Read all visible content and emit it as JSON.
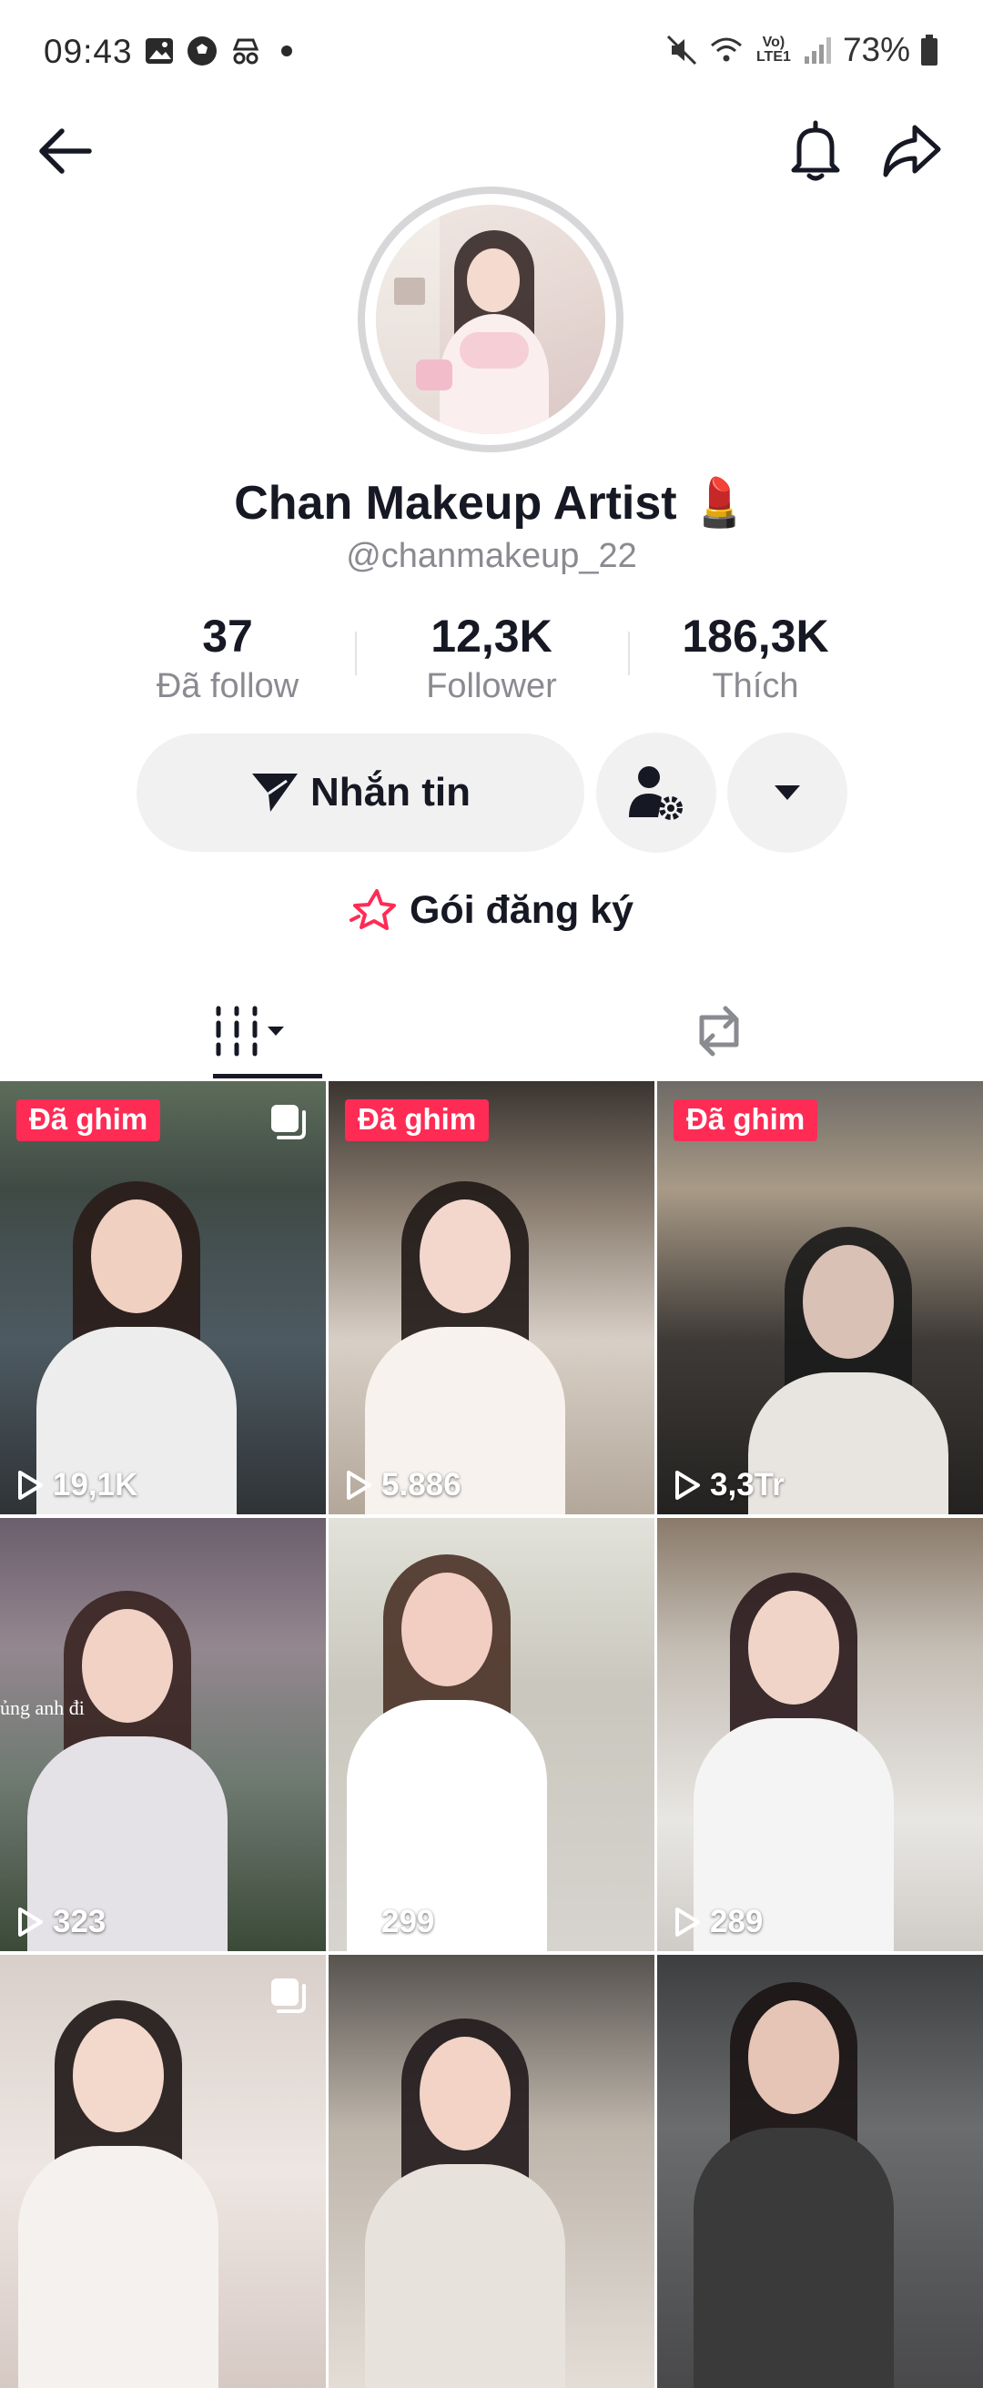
{
  "status_bar": {
    "time": "09:43",
    "network_label": "Vo) LTE1",
    "battery": "73%"
  },
  "header": {
    "back_icon": "arrow-left-icon",
    "bell_icon": "bell-icon",
    "share_icon": "share-arrow-icon"
  },
  "profile": {
    "display_name": "Chan Makeup Artist 💄",
    "username": "@chanmakeup_22"
  },
  "stats": [
    {
      "value": "37",
      "label": "Đã follow"
    },
    {
      "value": "12,3K",
      "label": "Follower"
    },
    {
      "value": "186,3K",
      "label": "Thích"
    }
  ],
  "actions": {
    "message_label": "Nhắn tin",
    "add_friend_icon": "person-settings-icon",
    "more_icon": "caret-down-icon"
  },
  "subscription": {
    "label": "Gói đăng ký",
    "icon": "star-outline-icon",
    "accent": "#fe2c55"
  },
  "tabs": [
    {
      "name": "videos-grid",
      "icon": "grid-bars-icon",
      "active": true
    },
    {
      "name": "reposts",
      "icon": "repost-icon",
      "active": false
    }
  ],
  "videos": [
    {
      "pinned": true,
      "pin_label": "Đã ghim",
      "views": "19,1K",
      "multi": true
    },
    {
      "pinned": true,
      "pin_label": "Đã ghim",
      "views": "5.886",
      "multi": false
    },
    {
      "pinned": true,
      "pin_label": "Đã ghim",
      "views": "3,3Tr",
      "multi": false
    },
    {
      "pinned": false,
      "pin_label": "",
      "views": "323",
      "multi": false,
      "overlay_text": "ủng anh đi"
    },
    {
      "pinned": false,
      "pin_label": "",
      "views": "299",
      "multi": false
    },
    {
      "pinned": false,
      "pin_label": "",
      "views": "289",
      "multi": false
    },
    {
      "pinned": false,
      "pin_label": "",
      "views": "",
      "multi": true
    },
    {
      "pinned": false,
      "pin_label": "",
      "views": "",
      "multi": false
    },
    {
      "pinned": false,
      "pin_label": "",
      "views": "",
      "multi": false
    }
  ],
  "colors": {
    "primary_text": "#161823",
    "secondary_text": "#8a8b91",
    "button_bg": "#f1f1f2",
    "pin_badge": "#fe2c55"
  }
}
